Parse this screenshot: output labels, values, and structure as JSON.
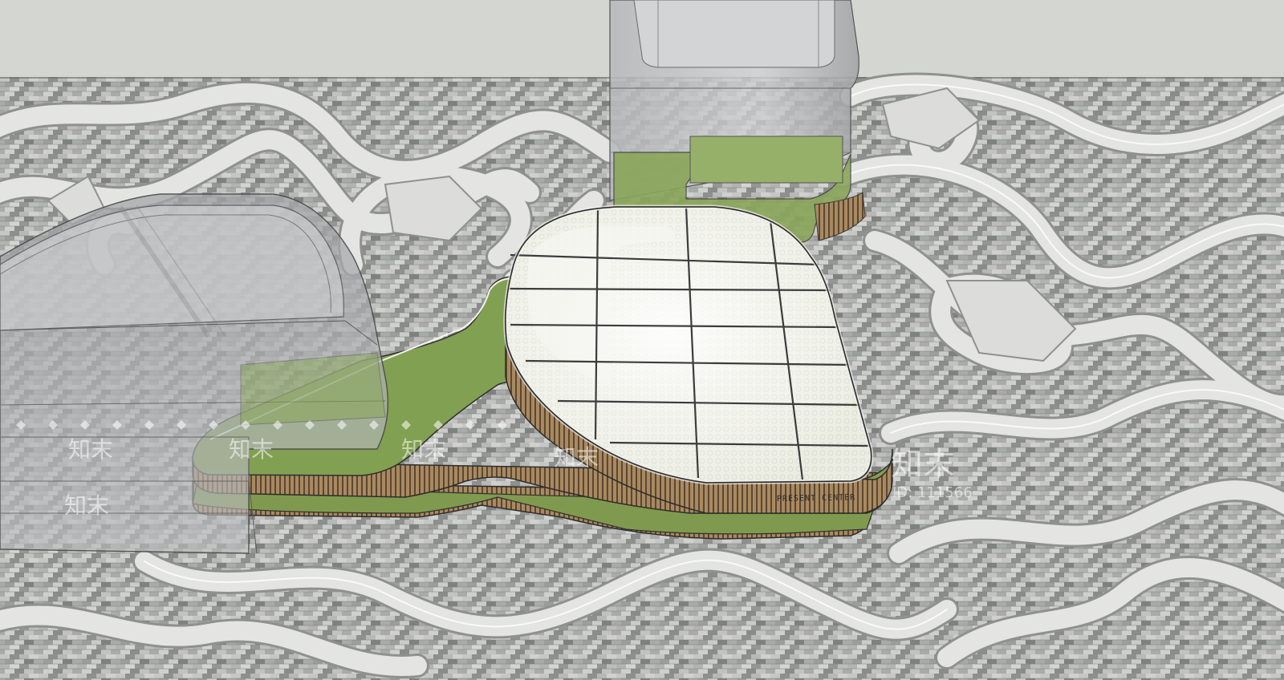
{
  "scene": {
    "colors": {
      "sky": "#d4d6d2",
      "plaza_paving": "#a9aba9",
      "plaza_paving_light": "#c3c4c2",
      "winding_path": "#e3e3e1",
      "path_edge": "#9a9c9a",
      "green_roof": "#7f9a4e",
      "timber_fins": "#8a6d4a",
      "glass_tower": "#bfc1c3",
      "skylight_glass": "#ecede2",
      "mullion": "#3c3c3c"
    }
  },
  "building": {
    "facade_sign": "PRESENT CENTER"
  },
  "watermark": {
    "brand": "知末",
    "id_label": "ID: 111566"
  }
}
